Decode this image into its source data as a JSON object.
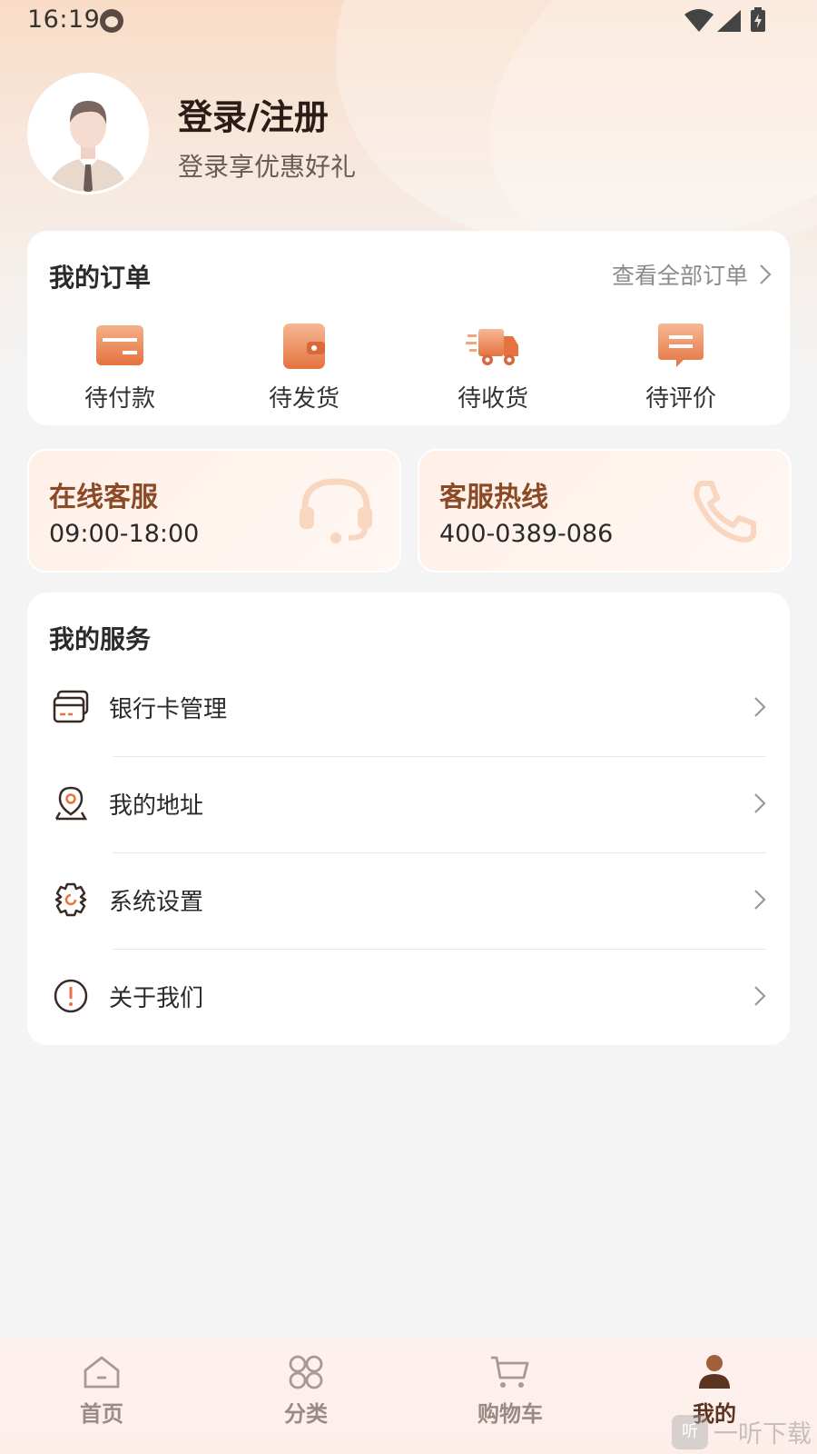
{
  "status_bar": {
    "time": "16:19"
  },
  "profile": {
    "title": "登录/注册",
    "subtitle": "登录享优惠好礼"
  },
  "orders": {
    "title": "我的订单",
    "view_all": "查看全部订单",
    "items": [
      {
        "label": "待付款",
        "icon": "card-icon"
      },
      {
        "label": "待发货",
        "icon": "wallet-icon"
      },
      {
        "label": "待收货",
        "icon": "truck-icon"
      },
      {
        "label": "待评价",
        "icon": "comment-icon"
      }
    ]
  },
  "contacts": [
    {
      "title": "在线客服",
      "value": "09:00-18:00",
      "icon": "headset-icon"
    },
    {
      "title": "客服热线",
      "value": "400-0389-086",
      "icon": "phone-icon"
    }
  ],
  "services": {
    "title": "我的服务",
    "items": [
      {
        "label": "银行卡管理",
        "icon": "bank-card-icon"
      },
      {
        "label": "我的地址",
        "icon": "location-icon"
      },
      {
        "label": "系统设置",
        "icon": "settings-icon"
      },
      {
        "label": "关于我们",
        "icon": "info-icon"
      }
    ]
  },
  "bottom_nav": [
    {
      "label": "首页",
      "icon": "home-icon",
      "active": false
    },
    {
      "label": "分类",
      "icon": "category-icon",
      "active": false
    },
    {
      "label": "购物车",
      "icon": "cart-icon",
      "active": false
    },
    {
      "label": "我的",
      "icon": "profile-icon",
      "active": true
    }
  ],
  "watermark": {
    "text": "一听下载"
  },
  "colors": {
    "accent": "#e8895a",
    "brand_dark": "#5b3321",
    "contact_title": "#8a4a26"
  }
}
